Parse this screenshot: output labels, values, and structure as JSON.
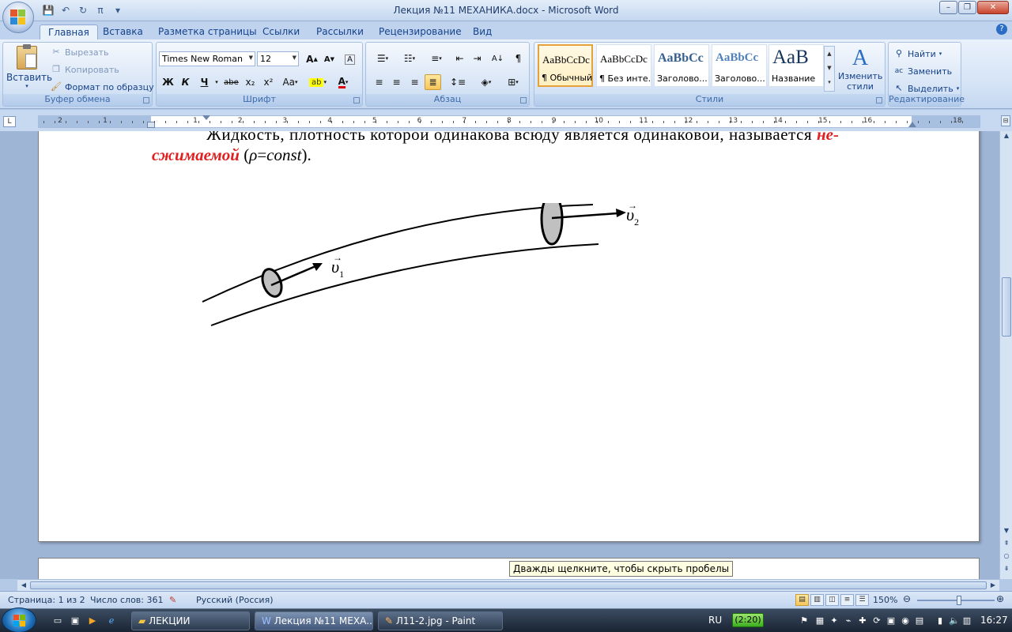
{
  "window": {
    "title": "Лекция №11 МЕХАНИКА.docx - Microsoft Word",
    "controls": {
      "minimize": "–",
      "maximize": "❐",
      "close": "✕"
    }
  },
  "quick_access": {
    "save": "💾",
    "undo": "↶",
    "redo": "↻",
    "formula": "π"
  },
  "tabs": [
    {
      "label": "Главная",
      "active": true
    },
    {
      "label": "Вставка"
    },
    {
      "label": "Разметка страницы"
    },
    {
      "label": "Ссылки"
    },
    {
      "label": "Рассылки"
    },
    {
      "label": "Рецензирование"
    },
    {
      "label": "Вид"
    }
  ],
  "help": "?",
  "clipboard": {
    "label": "Буфер обмена",
    "paste": "Вставить",
    "cut": "Вырезать",
    "copy": "Копировать",
    "format_painter": "Формат по образцу"
  },
  "font": {
    "label": "Шрифт",
    "name": "Times New Roman",
    "size": "12",
    "bold": "Ж",
    "italic": "К",
    "underline": "Ч",
    "strike": "abe",
    "subscript": "x₂",
    "superscript": "x²",
    "case": "Aa",
    "grow": "A",
    "shrink": "A",
    "clear": "A",
    "font_color": "A"
  },
  "paragraph": {
    "label": "Абзац",
    "pilcrow": "¶"
  },
  "styles": {
    "label": "Стили",
    "items": [
      {
        "sample": "AaBbCcDc",
        "name": "¶ Обычный",
        "selected": true
      },
      {
        "sample": "AaBbCcDc",
        "name": "¶ Без инте..."
      },
      {
        "sample": "AaBbCc",
        "name": "Заголово..."
      },
      {
        "sample": "AaBbCc",
        "name": "Заголово..."
      },
      {
        "sample": "AaB",
        "name": "Название"
      }
    ],
    "change_styles": "Изменить стили"
  },
  "editing": {
    "label": "Редактирование",
    "find": "Найти",
    "replace": "Заменить",
    "select": "Выделить"
  },
  "ruler": {
    "tab_selector": "L",
    "numbers_left": [
      "2",
      "1"
    ],
    "numbers_right": [
      "1",
      "2",
      "3",
      "4",
      "5",
      "6",
      "7",
      "8",
      "9",
      "10",
      "11",
      "12",
      "13",
      "14",
      "15",
      "16",
      "18"
    ]
  },
  "document": {
    "para_line1_start": "Жидкость, плотность которой одинакова всюду является одинаковой, называется ",
    "para_line1_em": "не-",
    "para_line2_em": "сжимаемой",
    "para_line2_open": " (",
    "para_rho": "ρ",
    "para_eq": "=",
    "para_const": "const",
    "para_line2_close": ").",
    "figure": {
      "v1_symbol": "υ",
      "v1_sub": "1",
      "v2_symbol": "υ",
      "v2_sub": "2"
    }
  },
  "tooltip": "Дважды щелкните, чтобы скрыть пробелы",
  "status": {
    "page": "Страница: 1 из 2",
    "words": "Число слов: 361",
    "language": "Русский (Россия)",
    "zoom": "150%"
  },
  "taskbar": {
    "buttons": [
      {
        "label": "ЛЕКЦИИ"
      },
      {
        "label": "Лекция №11 МЕХА...",
        "active": true
      },
      {
        "label": "Л11-2.jpg - Paint"
      }
    ],
    "lang": "RU",
    "battery": "(2:20)",
    "time": "16:27"
  },
  "colors": {
    "accent": "#15428b",
    "red_text": "#e02020",
    "figure_fill": "#c0c0c0"
  }
}
